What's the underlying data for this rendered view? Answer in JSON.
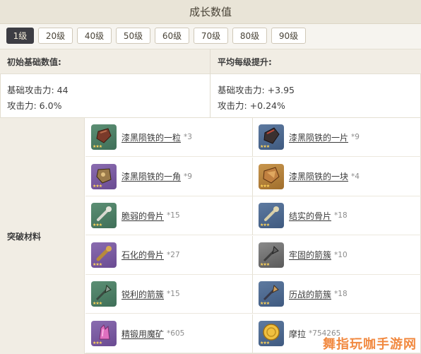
{
  "title": "成长数值",
  "levels": [
    "1级",
    "20级",
    "40级",
    "50级",
    "60级",
    "70级",
    "80级",
    "90级"
  ],
  "selected_level": "1级",
  "stats": {
    "base_header": "初始基础数值:",
    "growth_header": "平均每级提升:",
    "base": [
      "基础攻击力: 44",
      "攻击力: 6.0%"
    ],
    "growth": [
      "基础攻击力: +3.95",
      "攻击力: +0.24%"
    ]
  },
  "materials_label": "突破材料",
  "materials": [
    {
      "name": "漆黑陨铁的一粒",
      "count": "*3",
      "icon": "meteorite-shard-icon",
      "color": "green"
    },
    {
      "name": "漆黑陨铁的一片",
      "count": "*9",
      "icon": "meteorite-fragment-icon",
      "color": "blue"
    },
    {
      "name": "漆黑陨铁的一角",
      "count": "*9",
      "icon": "meteorite-chunk-icon",
      "color": "purple"
    },
    {
      "name": "漆黑陨铁的一块",
      "count": "*4",
      "icon": "meteorite-block-icon",
      "color": "gold"
    },
    {
      "name": "脆弱的骨片",
      "count": "*15",
      "icon": "fragile-bone-icon",
      "color": "green"
    },
    {
      "name": "结实的骨片",
      "count": "*18",
      "icon": "sturdy-bone-icon",
      "color": "blue"
    },
    {
      "name": "石化的骨片",
      "count": "*27",
      "icon": "fossilized-bone-icon",
      "color": "purple"
    },
    {
      "name": "牢固的箭簇",
      "count": "*10",
      "icon": "firm-arrowhead-icon",
      "color": "grey"
    },
    {
      "name": "锐利的箭簇",
      "count": "*15",
      "icon": "sharp-arrowhead-icon",
      "color": "green"
    },
    {
      "name": "历战的箭簇",
      "count": "*18",
      "icon": "weathered-arrowhead-icon",
      "color": "blue"
    },
    {
      "name": "精锻用魔矿",
      "count": "*605",
      "icon": "mystic-ore-icon",
      "color": "purple"
    },
    {
      "name": "摩拉",
      "count": "*754265",
      "icon": "mora-coin-icon",
      "color": "blue"
    }
  ],
  "watermark": "舞指玩咖手游网",
  "colors": {
    "selected_tab": "#3d3d44",
    "header_bg": "#e9e4d7",
    "accent_watermark": "#f07d2c"
  }
}
